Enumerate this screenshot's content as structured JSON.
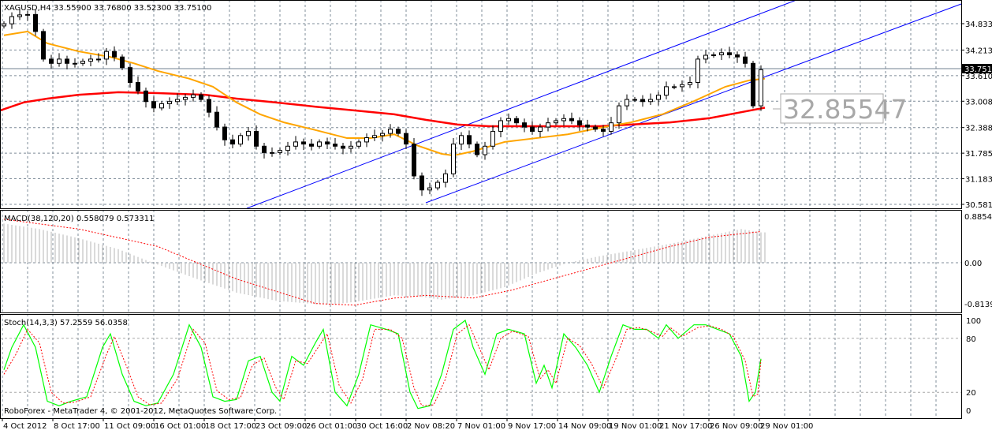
{
  "window": {
    "symbol_header": "XAGUSD,H4",
    "ohlc_header": "33.55900 33.76800 33.52300 33.75100",
    "current_price_label": "33.7510",
    "ma200_value_label": "32.85547",
    "copyright": "RoboForex - MetaTrader 4, © 2001-2012, MetaQuotes Software Corp."
  },
  "colors": {
    "candle": "#000000",
    "ma_fast": "#ffa500",
    "ma_slow": "#ff0000",
    "channel": "#0000ff",
    "macd_hist": "#c0c0c0",
    "macd_signal": "#ff0000",
    "stoch_main": "#00ff00",
    "stoch_signal": "#ff0000",
    "grid": "#7f8c99"
  },
  "chart_data": [
    {
      "type": "candlestick",
      "title": "XAGUSD,H4",
      "price_axis_ticks": [
        "34.8337",
        "34.2132",
        "33.6109",
        "33.0087",
        "32.3882",
        "31.7859",
        "31.1837",
        "30.5814"
      ],
      "price_axis_values": [
        34.8337,
        34.2132,
        33.6109,
        33.0087,
        32.3882,
        31.7859,
        31.1837,
        30.5814
      ],
      "ylim": [
        30.5814,
        34.8337
      ],
      "time_axis_ticks": [
        "4 Oct 2012",
        "8 Oct 17:00",
        "11 Oct 09:00",
        "16 Oct 01:00",
        "18 Oct 17:00",
        "23 Oct 09:00",
        "26 Oct 01:00",
        "30 Oct 16:00",
        "2 Nov 08:20",
        "7 Nov 01:00",
        "9 Nov 17:00",
        "14 Nov 09:00",
        "19 Nov 01:00",
        "21 Nov 17:00",
        "26 Nov 09:00",
        "29 Nov 01:00"
      ],
      "closes": [
        34.83,
        35.0,
        35.04,
        35.05,
        34.65,
        34.0,
        33.9,
        34.0,
        33.9,
        33.9,
        33.95,
        34.0,
        34.0,
        34.18,
        34.05,
        33.8,
        33.45,
        33.25,
        33.0,
        32.85,
        32.95,
        33.0,
        33.05,
        33.1,
        33.16,
        33.05,
        32.75,
        32.4,
        32.1,
        32.0,
        32.2,
        32.3,
        31.95,
        31.8,
        31.8,
        31.85,
        31.95,
        32.05,
        32.0,
        31.95,
        32.05,
        32.0,
        31.95,
        31.9,
        31.95,
        32.05,
        32.15,
        32.2,
        32.25,
        32.35,
        32.25,
        32.0,
        31.25,
        30.92,
        30.97,
        31.1,
        31.3,
        32.0,
        32.2,
        32.0,
        31.75,
        31.95,
        32.3,
        32.55,
        32.6,
        32.5,
        32.4,
        32.3,
        32.4,
        32.5,
        32.55,
        32.6,
        32.55,
        32.45,
        32.4,
        32.35,
        32.3,
        32.5,
        32.9,
        33.05,
        33.05,
        33.0,
        33.05,
        33.15,
        33.35,
        33.35,
        33.4,
        33.45,
        34.0,
        34.09,
        34.1,
        34.15,
        34.1,
        34.05,
        33.9,
        32.9,
        33.751
      ],
      "ma_fast": [
        [
          0,
          34.56
        ],
        [
          3,
          34.65
        ],
        [
          5.5,
          34.37
        ],
        [
          9.5,
          34.18
        ],
        [
          13.5,
          34.05
        ],
        [
          16.5,
          33.9
        ],
        [
          19.5,
          33.72
        ],
        [
          23.5,
          33.54
        ],
        [
          26.5,
          33.35
        ],
        [
          29.5,
          32.98
        ],
        [
          32.5,
          32.7
        ],
        [
          35.5,
          32.51
        ],
        [
          39.5,
          32.33
        ],
        [
          43.5,
          32.14
        ],
        [
          46.5,
          32.14
        ],
        [
          49.5,
          32.23
        ],
        [
          52.5,
          31.96
        ],
        [
          55.5,
          31.77
        ],
        [
          57,
          31.73
        ],
        [
          59.5,
          31.83
        ],
        [
          63.5,
          32.05
        ],
        [
          67.5,
          32.14
        ],
        [
          71.5,
          32.23
        ],
        [
          75.5,
          32.38
        ],
        [
          79.5,
          32.51
        ],
        [
          83.5,
          32.7
        ],
        [
          87.5,
          33.01
        ],
        [
          91.5,
          33.35
        ],
        [
          94.5,
          33.5
        ],
        [
          96.5,
          33.54
        ]
      ],
      "ma_slow": [
        [
          -0.5,
          32.79
        ],
        [
          2.5,
          32.98
        ],
        [
          5.5,
          33.07
        ],
        [
          9.5,
          33.16
        ],
        [
          14.5,
          33.22
        ],
        [
          19.5,
          33.2
        ],
        [
          25.5,
          33.16
        ],
        [
          29.5,
          33.07
        ],
        [
          34.5,
          32.98
        ],
        [
          39.5,
          32.88
        ],
        [
          44.5,
          32.79
        ],
        [
          49.5,
          32.7
        ],
        [
          53.5,
          32.57
        ],
        [
          57.5,
          32.46
        ],
        [
          61.5,
          32.42
        ],
        [
          69.5,
          32.42
        ],
        [
          75.5,
          32.42
        ],
        [
          79.5,
          32.46
        ],
        [
          84.5,
          32.51
        ],
        [
          89.5,
          32.61
        ],
        [
          93.5,
          32.75
        ],
        [
          96.5,
          32.85547
        ]
      ]
    },
    {
      "type": "bar",
      "title": "MACD(38,120,20) 0.558079 0.573311",
      "axis_ticks": [
        "0.88546",
        "0.00",
        "-0.81392"
      ],
      "ylim": [
        -0.81392,
        0.88546
      ],
      "macd": [
        [
          0,
          0.72
        ],
        [
          4.5,
          0.62
        ],
        [
          9.5,
          0.45
        ],
        [
          14.5,
          0.25
        ],
        [
          18.5,
          0.02
        ],
        [
          24.5,
          -0.3
        ],
        [
          29.5,
          -0.55
        ],
        [
          34.5,
          -0.7
        ],
        [
          39.5,
          -0.76
        ],
        [
          41.5,
          -0.77
        ],
        [
          44.5,
          -0.72
        ],
        [
          49.5,
          -0.6
        ],
        [
          52.5,
          -0.62
        ],
        [
          55.5,
          -0.68
        ],
        [
          59.5,
          -0.6
        ],
        [
          63.5,
          -0.45
        ],
        [
          67.5,
          -0.2
        ],
        [
          71.5,
          0.0
        ],
        [
          75.5,
          0.12
        ],
        [
          79.5,
          0.22
        ],
        [
          84.5,
          0.35
        ],
        [
          89.5,
          0.5
        ],
        [
          93.5,
          0.62
        ],
        [
          96,
          0.558079
        ]
      ],
      "signal": [
        [
          0,
          0.8
        ],
        [
          9.5,
          0.62
        ],
        [
          19.5,
          0.3
        ],
        [
          29.5,
          -0.3
        ],
        [
          39.5,
          -0.75
        ],
        [
          44.5,
          -0.78
        ],
        [
          49.5,
          -0.65
        ],
        [
          53.5,
          -0.6
        ],
        [
          59.5,
          -0.65
        ],
        [
          64.5,
          -0.5
        ],
        [
          69.5,
          -0.3
        ],
        [
          74.5,
          -0.1
        ],
        [
          79.5,
          0.1
        ],
        [
          84.5,
          0.3
        ],
        [
          89.5,
          0.47
        ],
        [
          96,
          0.573311
        ]
      ]
    },
    {
      "type": "line",
      "title": "Stoch(14,3,3) 57.2559 56.0358",
      "axis_ticks": [
        "100",
        "80",
        "20",
        "0"
      ],
      "ylim": [
        0,
        100
      ],
      "k": [
        [
          0,
          45
        ],
        [
          1,
          70
        ],
        [
          2.5,
          95
        ],
        [
          4,
          70
        ],
        [
          5.5,
          10
        ],
        [
          7,
          5
        ],
        [
          8.5,
          10
        ],
        [
          10.5,
          15
        ],
        [
          12.5,
          70
        ],
        [
          13.5,
          85
        ],
        [
          15,
          40
        ],
        [
          16.5,
          10
        ],
        [
          18,
          5
        ],
        [
          19.5,
          8
        ],
        [
          21.5,
          40
        ],
        [
          23.5,
          95
        ],
        [
          25,
          70
        ],
        [
          26.5,
          15
        ],
        [
          28,
          10
        ],
        [
          29.5,
          12
        ],
        [
          31,
          55
        ],
        [
          32.5,
          60
        ],
        [
          34,
          20
        ],
        [
          35,
          10
        ],
        [
          36.5,
          60
        ],
        [
          38,
          50
        ],
        [
          39.5,
          75
        ],
        [
          40.5,
          90
        ],
        [
          42,
          20
        ],
        [
          43.5,
          5
        ],
        [
          45,
          40
        ],
        [
          46.5,
          95
        ],
        [
          48.5,
          90
        ],
        [
          50,
          85
        ],
        [
          51.5,
          20
        ],
        [
          52.5,
          2
        ],
        [
          54,
          5
        ],
        [
          55.5,
          40
        ],
        [
          57,
          90
        ],
        [
          58.5,
          100
        ],
        [
          59.5,
          70
        ],
        [
          61,
          40
        ],
        [
          62.5,
          85
        ],
        [
          64,
          90
        ],
        [
          66,
          85
        ],
        [
          67.5,
          30
        ],
        [
          68.5,
          50
        ],
        [
          69.5,
          25
        ],
        [
          71,
          85
        ],
        [
          72.5,
          70
        ],
        [
          74,
          50
        ],
        [
          75.5,
          20
        ],
        [
          77,
          60
        ],
        [
          78.5,
          95
        ],
        [
          80,
          90
        ],
        [
          81.5,
          90
        ],
        [
          83,
          80
        ],
        [
          84,
          95
        ],
        [
          85.5,
          80
        ],
        [
          87.5,
          95
        ],
        [
          89,
          95
        ],
        [
          90.5,
          90
        ],
        [
          92,
          85
        ],
        [
          93.5,
          60
        ],
        [
          94.5,
          10
        ],
        [
          95.3,
          20
        ],
        [
          96,
          57.2559
        ]
      ],
      "d": [
        [
          0,
          40
        ],
        [
          1.5,
          62
        ],
        [
          3,
          90
        ],
        [
          4.5,
          75
        ],
        [
          6,
          20
        ],
        [
          7.5,
          8
        ],
        [
          9,
          9
        ],
        [
          11,
          15
        ],
        [
          13,
          62
        ],
        [
          14,
          82
        ],
        [
          15.5,
          50
        ],
        [
          17,
          15
        ],
        [
          18.5,
          6
        ],
        [
          20,
          8
        ],
        [
          22,
          35
        ],
        [
          24,
          90
        ],
        [
          25.5,
          75
        ],
        [
          27,
          22
        ],
        [
          28.5,
          12
        ],
        [
          30,
          14
        ],
        [
          31.5,
          50
        ],
        [
          33,
          58
        ],
        [
          34.5,
          25
        ],
        [
          35.5,
          12
        ],
        [
          37,
          55
        ],
        [
          38.5,
          52
        ],
        [
          40,
          72
        ],
        [
          41,
          85
        ],
        [
          42.5,
          28
        ],
        [
          44,
          8
        ],
        [
          45.5,
          35
        ],
        [
          47,
          90
        ],
        [
          49,
          90
        ],
        [
          50.5,
          80
        ],
        [
          52,
          25
        ],
        [
          53,
          5
        ],
        [
          54.5,
          6
        ],
        [
          56,
          35
        ],
        [
          57.5,
          85
        ],
        [
          59,
          95
        ],
        [
          60,
          75
        ],
        [
          61.5,
          45
        ],
        [
          63,
          80
        ],
        [
          64.5,
          88
        ],
        [
          66.5,
          82
        ],
        [
          68,
          35
        ],
        [
          69,
          45
        ],
        [
          70,
          30
        ],
        [
          71.5,
          80
        ],
        [
          73,
          72
        ],
        [
          74.5,
          52
        ],
        [
          76,
          25
        ],
        [
          77.5,
          55
        ],
        [
          79,
          90
        ],
        [
          80.5,
          92
        ],
        [
          82,
          88
        ],
        [
          83.5,
          82
        ],
        [
          84.5,
          92
        ],
        [
          86,
          82
        ],
        [
          88,
          92
        ],
        [
          89.5,
          94
        ],
        [
          91,
          90
        ],
        [
          92.5,
          82
        ],
        [
          94,
          55
        ],
        [
          95,
          15
        ],
        [
          95.6,
          18
        ],
        [
          96,
          56.0358
        ]
      ]
    }
  ]
}
